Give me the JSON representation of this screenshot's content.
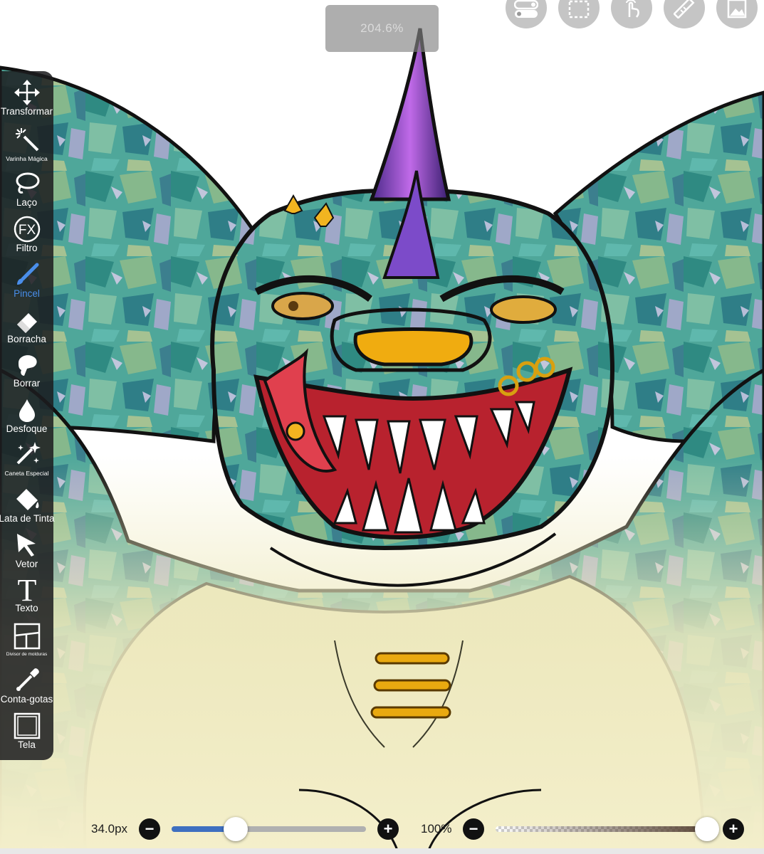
{
  "zoom": {
    "value": "204.6%"
  },
  "top_actions": [
    {
      "name": "layers-toggle-icon"
    },
    {
      "name": "selection-icon"
    },
    {
      "name": "touch-gesture-icon"
    },
    {
      "name": "ruler-icon"
    },
    {
      "name": "image-layer-icon"
    }
  ],
  "toolbar": {
    "tools": [
      {
        "id": "transform",
        "label": "Transformar",
        "icon": "move-arrows-icon",
        "size": "normal",
        "active": false
      },
      {
        "id": "magic-wand",
        "label": "Varinha Mágica",
        "icon": "magic-wand-icon",
        "size": "small",
        "active": false
      },
      {
        "id": "lasso",
        "label": "Laço",
        "icon": "lasso-icon",
        "size": "normal",
        "active": false
      },
      {
        "id": "filter",
        "label": "Filtro",
        "icon": "fx-icon",
        "size": "normal",
        "active": false
      },
      {
        "id": "brush",
        "label": "Pincel",
        "icon": "brush-icon",
        "size": "normal",
        "active": true
      },
      {
        "id": "eraser",
        "label": "Borracha",
        "icon": "eraser-icon",
        "size": "normal",
        "active": false
      },
      {
        "id": "smudge",
        "label": "Borrar",
        "icon": "smudge-finger-icon",
        "size": "normal",
        "active": false
      },
      {
        "id": "blur",
        "label": "Desfoque",
        "icon": "drop-icon",
        "size": "normal",
        "active": false
      },
      {
        "id": "special-pen",
        "label": "Caneta Especial",
        "icon": "sparkle-pen-icon",
        "size": "small",
        "active": false
      },
      {
        "id": "paint-bucket",
        "label": "Lata de Tinta",
        "icon": "paint-bucket-icon",
        "size": "normal",
        "active": false
      },
      {
        "id": "vector",
        "label": "Vetor",
        "icon": "cursor-arrow-icon",
        "size": "normal",
        "active": false
      },
      {
        "id": "text",
        "label": "Texto",
        "icon": "text-t-icon",
        "size": "normal",
        "active": false
      },
      {
        "id": "frame-divider",
        "label": "Divisor de molduras",
        "icon": "frame-divider-icon",
        "size": "tiny",
        "active": false
      },
      {
        "id": "eyedropper",
        "label": "Conta-gotas",
        "icon": "eyedropper-icon",
        "size": "normal",
        "active": false
      },
      {
        "id": "canvas",
        "label": "Tela",
        "icon": "canvas-square-icon",
        "size": "normal",
        "active": false
      }
    ]
  },
  "brush_size": {
    "value_text": "34.0px",
    "level": 0.33,
    "minus_label": "−",
    "plus_label": "+"
  },
  "opacity": {
    "value_text": "100%",
    "level": 1.0,
    "minus_label": "−",
    "plus_label": "+"
  },
  "colors": {
    "accent": "#4a8eea",
    "size_track_fill": "#3e6fc0",
    "size_track_bg": "#b0b0b0"
  }
}
